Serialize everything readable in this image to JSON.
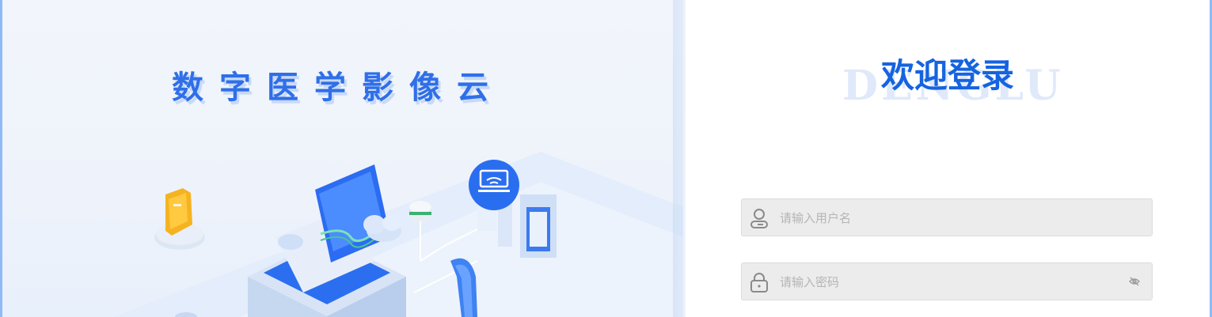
{
  "hero": {
    "title": "数字医学影像云"
  },
  "login": {
    "watermark": "DENGLU",
    "title": "欢迎登录",
    "username": {
      "value": "",
      "placeholder": "请输入用户名",
      "icon": "user-icon"
    },
    "password": {
      "value": "",
      "placeholder": "请输入密码",
      "icon": "lock-icon",
      "toggle_icon": "eye-off-icon"
    }
  },
  "colors": {
    "accent": "#1663e0",
    "hero_title": "#2f6fe8",
    "field_bg": "#ececec",
    "placeholder": "#b5b5b5"
  }
}
